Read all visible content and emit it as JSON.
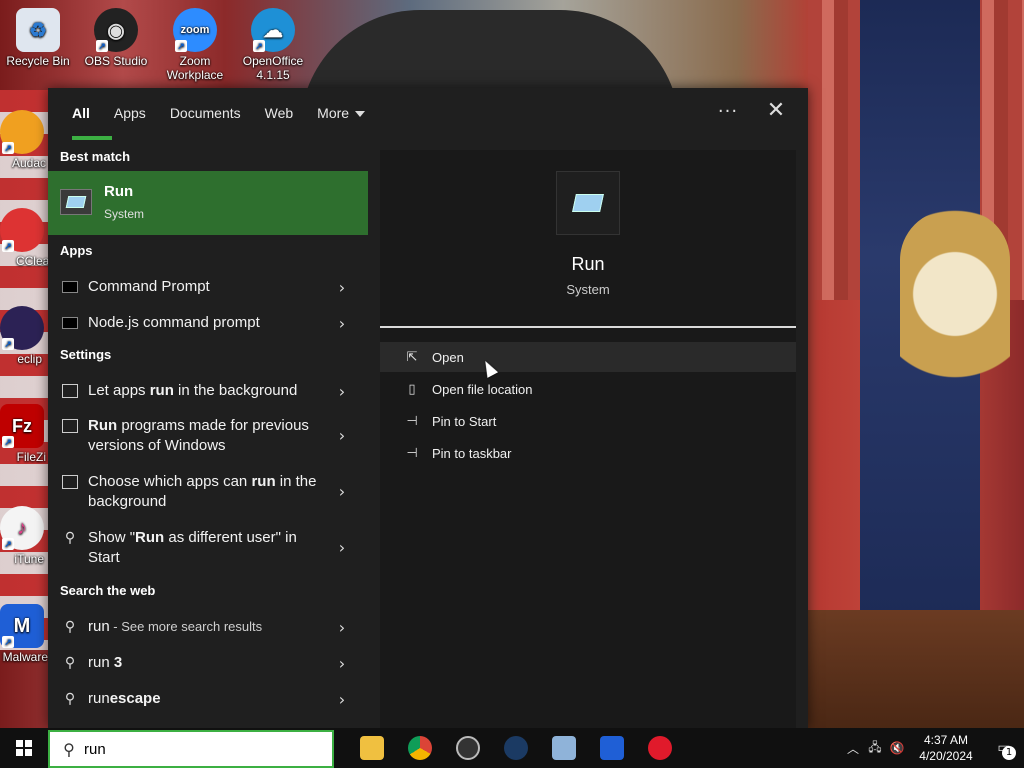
{
  "desktop": {
    "icons": [
      {
        "label": "Recycle Bin"
      },
      {
        "label": "OBS Studio"
      },
      {
        "label": "Zoom Workplace"
      },
      {
        "label": "OpenOffice 4.1.15"
      },
      {
        "label": "Audac"
      },
      {
        "label": "CClean"
      },
      {
        "label": "eclip"
      },
      {
        "label": "FileZi"
      },
      {
        "label": "iTune"
      },
      {
        "label": "Malware"
      }
    ]
  },
  "search": {
    "tabs": [
      {
        "label": "All",
        "active": true
      },
      {
        "label": "Apps"
      },
      {
        "label": "Documents"
      },
      {
        "label": "Web"
      },
      {
        "label": "More"
      }
    ],
    "more_options_icon": "ellipsis-icon",
    "close_icon": "close-icon",
    "sections": {
      "best_match": "Best match",
      "apps": "Apps",
      "settings": "Settings",
      "web": "Search the web"
    },
    "best_match": {
      "title": "Run",
      "subtitle": "System"
    },
    "apps": [
      {
        "label": "Command Prompt"
      },
      {
        "label": "Node.js command prompt"
      }
    ],
    "settings": [
      {
        "pre": "Let apps ",
        "bold": "run",
        "post": " in the background"
      },
      {
        "pre": "",
        "bold": "Run",
        "post": " programs made for previous versions of Windows"
      },
      {
        "pre": "Choose which apps can ",
        "bold": "run",
        "post": " in the background"
      },
      {
        "pre": "Show \"",
        "bold": "Run",
        "post": " as different user\" in Start"
      }
    ],
    "web": [
      {
        "text": "run",
        "muted": " - See more search results"
      },
      {
        "pre": "run ",
        "bold": "3"
      },
      {
        "pre": "run",
        "bold": "escape"
      }
    ],
    "preview": {
      "title": "Run",
      "subtitle": "System",
      "actions": [
        {
          "label": "Open",
          "icon": "open-icon"
        },
        {
          "label": "Open file location",
          "icon": "file-location-icon"
        },
        {
          "label": "Pin to Start",
          "icon": "pin-icon"
        },
        {
          "label": "Pin to taskbar",
          "icon": "pin-icon"
        }
      ]
    }
  },
  "taskbar": {
    "search_value": "run",
    "apps": [
      "file-explorer",
      "chrome",
      "obs",
      "steam",
      "notepad",
      "malwarebytes",
      "opera"
    ],
    "clock_time": "4:37 AM",
    "clock_date": "4/20/2024",
    "notification_count": "1"
  }
}
